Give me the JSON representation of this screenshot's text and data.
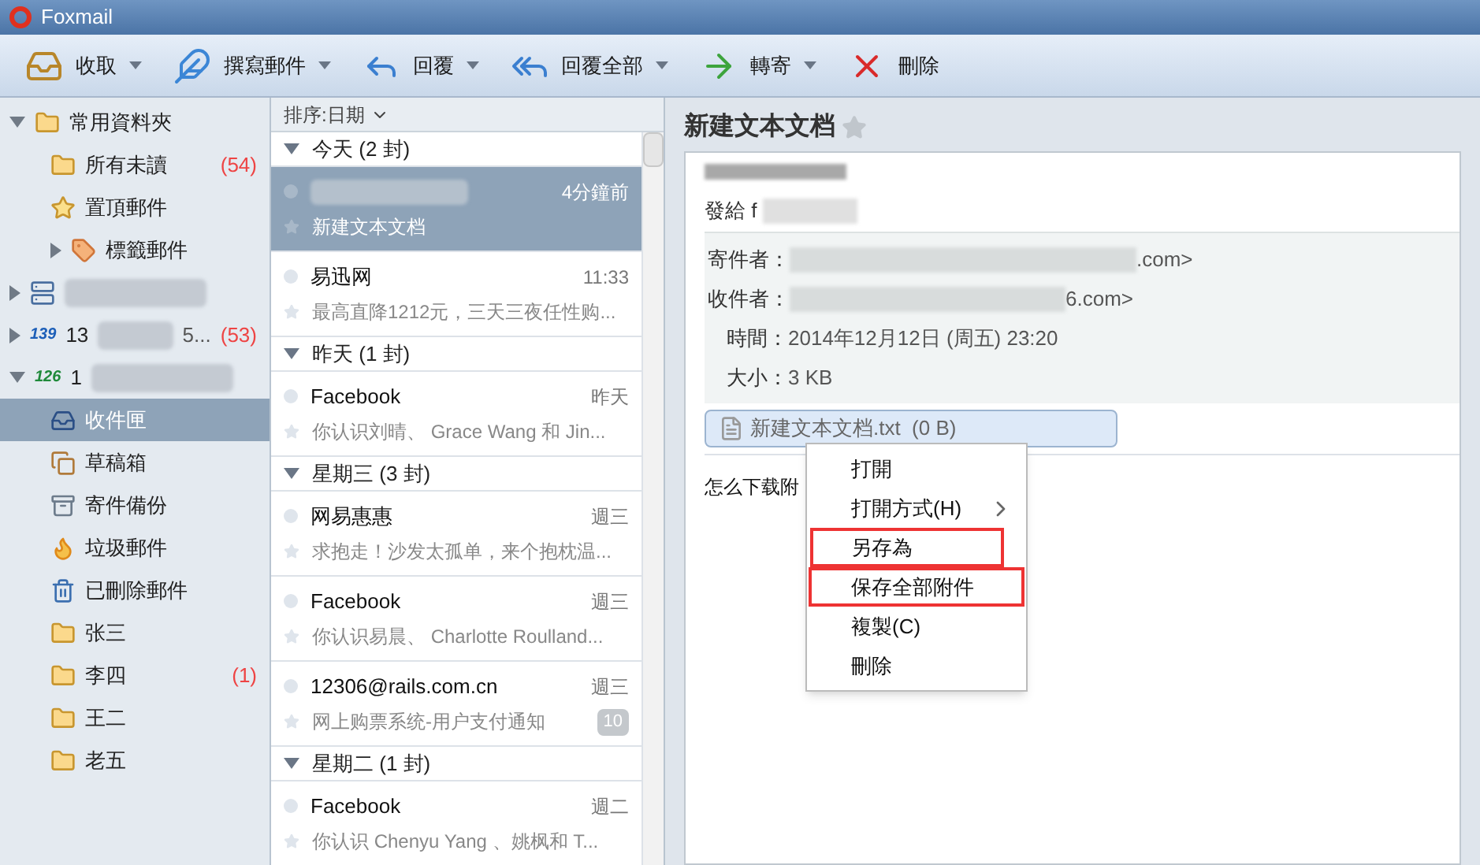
{
  "window": {
    "title": "Foxmail"
  },
  "toolbar": [
    {
      "label": "收取",
      "dropdown": true
    },
    {
      "label": "撰寫郵件",
      "dropdown": true
    },
    {
      "label": "回覆",
      "dropdown": true
    },
    {
      "label": "回覆全部",
      "dropdown": true
    },
    {
      "label": "轉寄",
      "dropdown": true
    },
    {
      "label": "刪除",
      "dropdown": false
    }
  ],
  "sidebar": {
    "items": [
      {
        "label": "常用資料夾",
        "expanded": true,
        "selected": false,
        "children": [
          {
            "label": "所有未讀",
            "count": "(54)",
            "selected": false
          },
          {
            "label": "置頂郵件",
            "selected": false
          },
          {
            "label": "標籤郵件",
            "expanded": false,
            "selected": false
          }
        ]
      },
      {
        "expanded": false,
        "blurred": true,
        "selected": false
      },
      {
        "label": "13",
        "logo": "139",
        "tail": "5...",
        "count": "(53)",
        "expanded": false,
        "blurred": true,
        "selected": false
      },
      {
        "label": "1",
        "logo": "126",
        "expanded": true,
        "blurred": true,
        "selected": false,
        "children": [
          {
            "label": "收件匣",
            "selected": true
          },
          {
            "label": "草稿箱",
            "selected": false
          },
          {
            "label": "寄件備份",
            "selected": false
          },
          {
            "label": "垃圾郵件",
            "selected": false
          },
          {
            "label": "已刪除郵件",
            "selected": false
          },
          {
            "label": "张三",
            "selected": false
          },
          {
            "label": "李四",
            "count": "(1)",
            "selected": false
          },
          {
            "label": "王二",
            "selected": false
          },
          {
            "label": "老五",
            "selected": false
          }
        ]
      }
    ]
  },
  "message_list": {
    "sort": "排序:日期",
    "groups": [
      {
        "label": "今天 (2 封)",
        "messages": [
          {
            "sender_blurred": true,
            "time": "4分鐘前",
            "preview": "新建文本文档",
            "selected": true
          },
          {
            "sender": "易迅网",
            "time": "11:33",
            "preview": "最高直降1212元，三天三夜任性购...",
            "selected": false
          }
        ]
      },
      {
        "label": "昨天 (1 封)",
        "messages": [
          {
            "sender": "Facebook",
            "time": "昨天",
            "preview": "你认识刘晴、 Grace Wang 和 Jin...",
            "selected": false
          }
        ]
      },
      {
        "label": "星期三 (3 封)",
        "messages": [
          {
            "sender": "网易惠惠",
            "time": "週三",
            "preview": "求抱走！沙发太孤单，来个抱枕温...",
            "selected": false
          },
          {
            "sender": "Facebook",
            "time": "週三",
            "preview": "你认识易晨、 Charlotte Roulland...",
            "selected": false
          },
          {
            "sender": "12306@rails.com.cn",
            "time": "週三",
            "preview": "网上购票系统-用户支付通知",
            "badge": "10",
            "selected": false
          }
        ]
      },
      {
        "label": "星期二 (1 封)",
        "messages": [
          {
            "sender": "Facebook",
            "time": "週二",
            "preview": "你认识 Chenyu Yang 、姚枫和 T...",
            "selected": false
          }
        ]
      }
    ]
  },
  "reader": {
    "subject": "新建文本文档",
    "starred": false,
    "to_line": "發給 f",
    "headers": [
      {
        "label": "寄件者：",
        "value": ".com>"
      },
      {
        "label": "收件者：",
        "value": "6.com>"
      },
      {
        "label": "時間：",
        "value": "2014年12月12日 (周五) 23:20"
      },
      {
        "label": "大小：",
        "value": "3 KB"
      }
    ],
    "attachment": "新建文本文档.txt  (0 B)",
    "body": "怎么下载附"
  },
  "context_menu": [
    {
      "label": "打開",
      "submenu": false,
      "annotated": false
    },
    {
      "label": "打開方式(H)",
      "submenu": true,
      "annotated": false
    },
    {
      "label": "另存為",
      "submenu": false,
      "annotated": true
    },
    {
      "label": "保存全部附件",
      "submenu": false,
      "annotated": true
    },
    {
      "label": "複製(C)",
      "submenu": false,
      "annotated": false
    },
    {
      "label": "刪除",
      "submenu": false,
      "annotated": false
    }
  ]
}
